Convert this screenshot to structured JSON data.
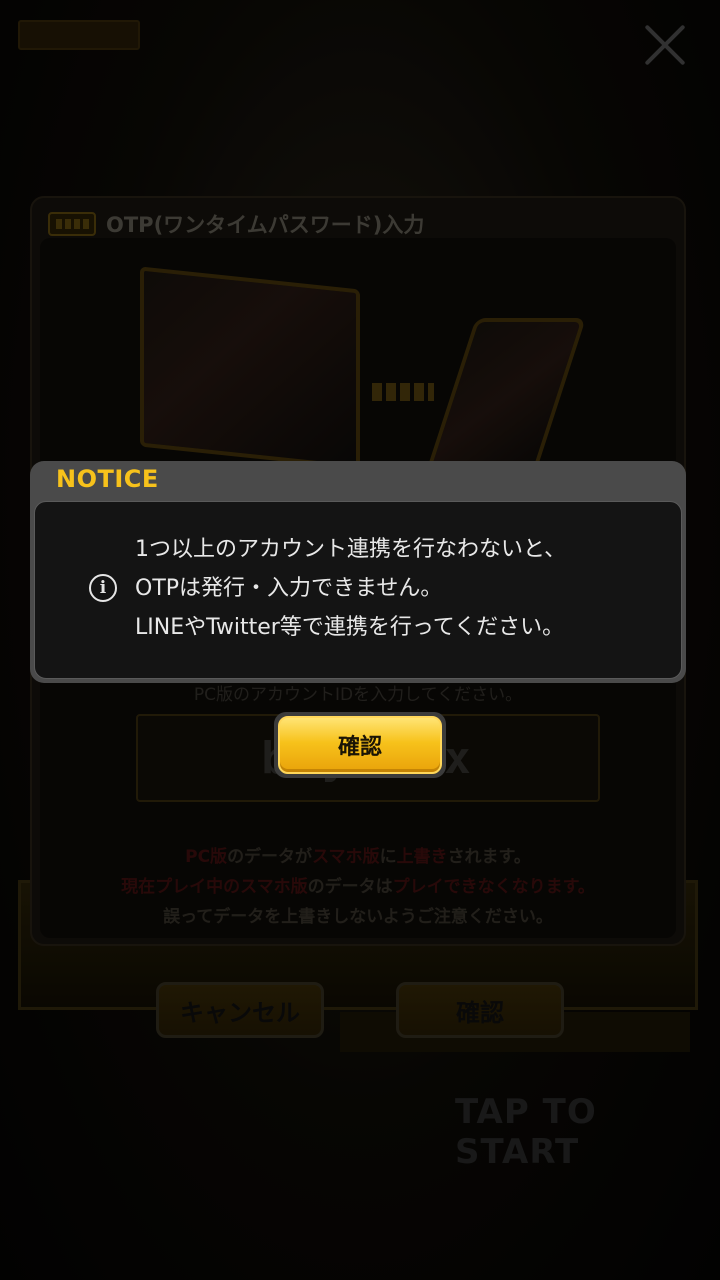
{
  "background": {
    "tap_to_start": "TAP TO START"
  },
  "otp_panel": {
    "title": "OTP(ワンタイムパスワード)入力",
    "hint": "PC版のアカウントIDを入力してください。",
    "code_value": "bsy    5wx",
    "warning": {
      "line1_part1": "PC版",
      "line1_part2": "のデータが",
      "line1_part3": "スマホ版",
      "line1_part4": "に",
      "line1_part5": "上書き",
      "line1_part6": "されます。",
      "line2_part1": "現在プレイ中のスマホ版",
      "line2_part2": "のデータは",
      "line2_part3": "プレイできなくなります。",
      "line3": "誤ってデータを上書きしないようご注意ください。"
    },
    "cancel_label": "キャンセル",
    "confirm_label": "確認"
  },
  "notice": {
    "title": "NOTICE",
    "lines": [
      "1つ以上のアカウント連携を行なわないと、",
      "OTPは発行・入力できません。",
      "LINEやTwitter等で連携を行ってください。"
    ],
    "confirm_label": "確認"
  },
  "colors": {
    "accent": "#f7c21b",
    "notice_bg": "#141414"
  }
}
